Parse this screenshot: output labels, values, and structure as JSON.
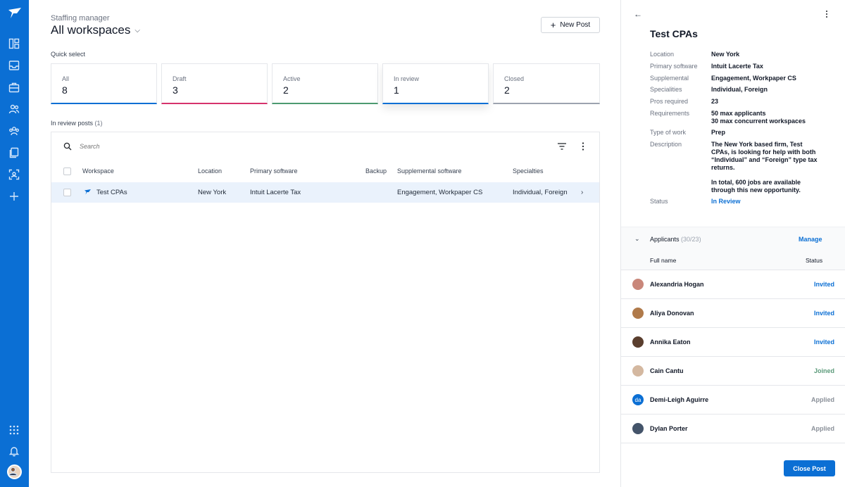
{
  "colors": {
    "brand": "#0b6fd4",
    "invited": "#0b6fd4",
    "joined": "#5b9a7a",
    "applied": "#8a9099"
  },
  "header": {
    "eyebrow": "Staffing manager",
    "title": "All workspaces",
    "new_post": "New Post"
  },
  "quick_select": {
    "label": "Quick select",
    "cards": [
      {
        "label": "All",
        "count": "8",
        "color": "#0b6fd4"
      },
      {
        "label": "Draft",
        "count": "3",
        "color": "#d6336c"
      },
      {
        "label": "Active",
        "count": "2",
        "color": "#4c9a70"
      },
      {
        "label": "In review",
        "count": "1",
        "color": "#0b6fd4",
        "selected": true
      },
      {
        "label": "Closed",
        "count": "2",
        "color": "#9ca3af"
      }
    ]
  },
  "list": {
    "label": "In review posts",
    "count": "(1)",
    "search_placeholder": "Search",
    "columns": [
      "Workspace",
      "Location",
      "Primary software",
      "Backup",
      "Supplemental software",
      "Specialties"
    ],
    "rows": [
      {
        "workspace": "Test CPAs",
        "location": "New York",
        "primary": "Intuit Lacerte Tax",
        "backup": "",
        "supplemental": "Engagement, Workpaper CS",
        "specialties": "Individual, Foreign"
      }
    ]
  },
  "panel": {
    "title": "Test CPAs",
    "details": [
      {
        "label": "Location",
        "value": "New York"
      },
      {
        "label": "Primary software",
        "value": "Intuit Lacerte Tax"
      },
      {
        "label": "Supplemental",
        "value": "Engagement, Workpaper CS"
      },
      {
        "label": "Specialities",
        "value": "Individual, Foreign"
      },
      {
        "label": "Pros required",
        "value": "23"
      },
      {
        "label": "Requirements",
        "value": "50 max applicants",
        "value2": "30 max concurrent workspaces"
      },
      {
        "label": "Type of work",
        "value": "Prep"
      },
      {
        "label": "Description",
        "value": "The New York based firm, Test CPAs, is looking for help with both “Individual” and “Foreign” type tax returns.",
        "value2": "In total, 600 jobs are available through this new opportunity."
      },
      {
        "label": "Status",
        "value": "In Review"
      }
    ],
    "applicants": {
      "title": "Applicants",
      "count": "(30/23)",
      "manage": "Manage",
      "col_name": "Full name",
      "col_status": "Status",
      "rows": [
        {
          "name": "Alexandria Hogan",
          "status": "Invited",
          "avatar": "#c9877a"
        },
        {
          "name": "Aliya Donovan",
          "status": "Invited",
          "avatar": "#b07a4a"
        },
        {
          "name": "Annika Eaton",
          "status": "Invited",
          "avatar": "#5a3e2e"
        },
        {
          "name": "Cain Cantu",
          "status": "Joined",
          "avatar": "#d4b8a0"
        },
        {
          "name": "Demi-Leigh Aguirre",
          "status": "Applied",
          "initials": "da"
        },
        {
          "name": "Dylan Porter",
          "status": "Applied",
          "avatar": "#44546a"
        }
      ]
    },
    "close_post": "Close Post"
  }
}
